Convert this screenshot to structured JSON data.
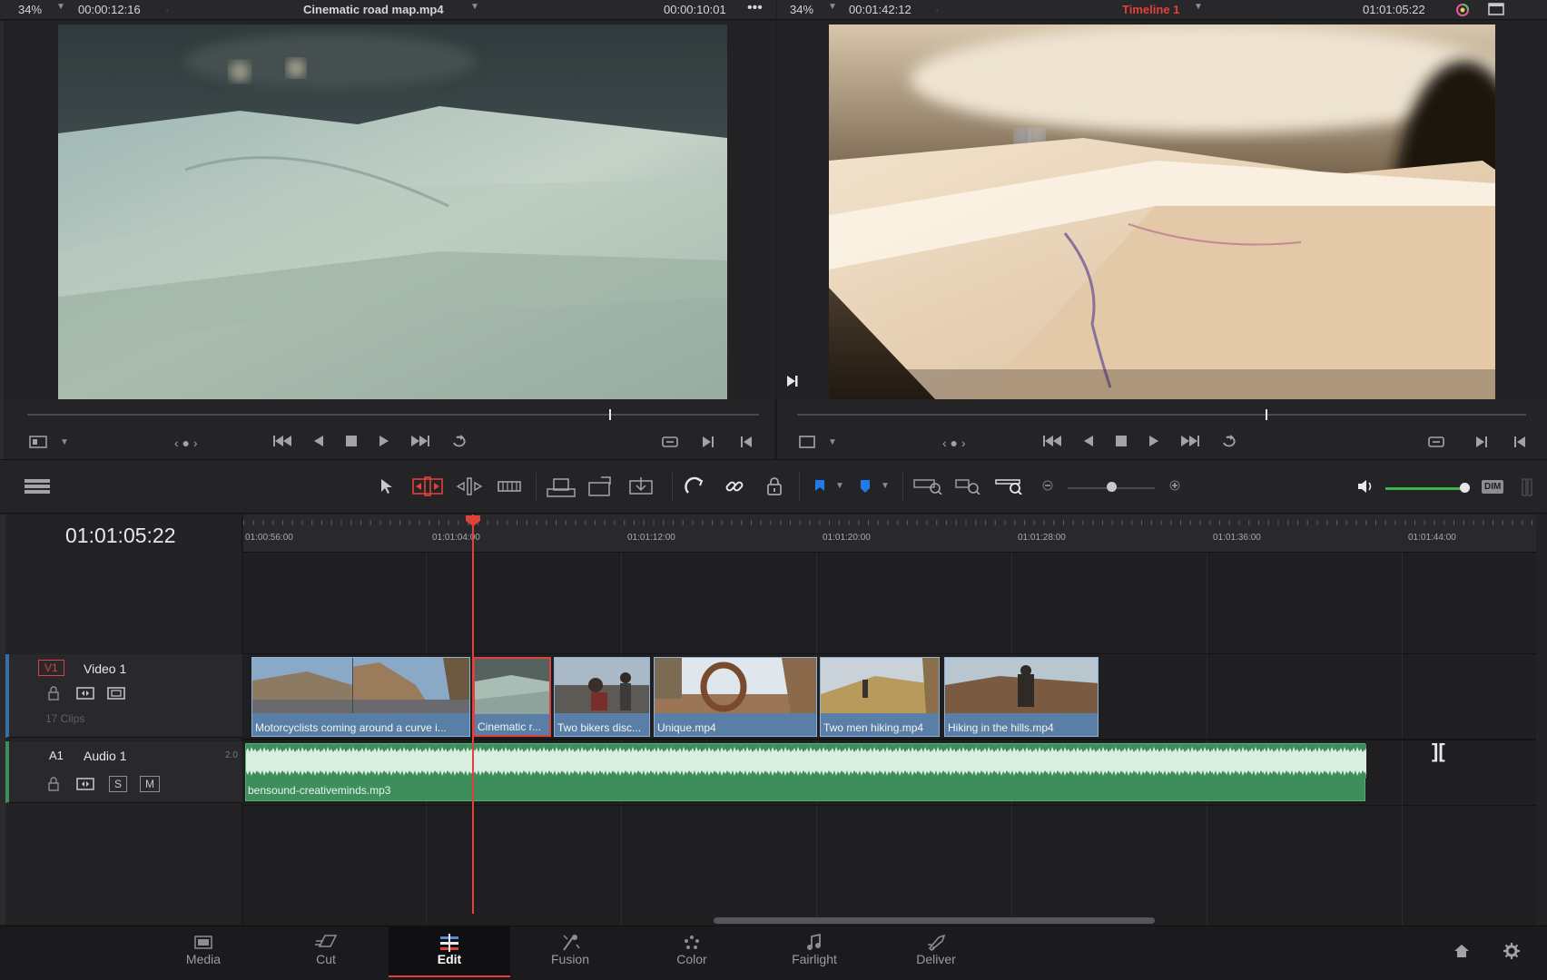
{
  "source_viewer": {
    "zoom": "34%",
    "duration": "00:00:12:16",
    "clip_name": "Cinematic road map.mp4",
    "timecode": "00:00:10:01"
  },
  "timeline_viewer": {
    "zoom": "34%",
    "duration": "00:01:42:12",
    "timeline_name": "Timeline 1",
    "timecode": "01:01:05:22"
  },
  "timeline": {
    "current_timecode": "01:01:05:22",
    "ruler_labels": [
      "01:00:56:00",
      "01:01:04:00",
      "01:01:12:00",
      "01:01:20:00",
      "01:01:28:00",
      "01:01:36:00",
      "01:01:44:00"
    ],
    "video_track": {
      "id": "V1",
      "name": "Video 1",
      "clip_count": "17 Clips",
      "clips": [
        {
          "name": "Motorcyclists coming around a curve i..."
        },
        {
          "name": "Cinematic r..."
        },
        {
          "name": "Two bikers disc..."
        },
        {
          "name": "Unique.mp4"
        },
        {
          "name": "Two men hiking.mp4"
        },
        {
          "name": "Hiking in the hills.mp4"
        }
      ]
    },
    "audio_track": {
      "id": "A1",
      "name": "Audio 1",
      "channels": "2.0",
      "solo": "S",
      "mute": "M",
      "clip_name": "bensound-creativeminds.mp3"
    }
  },
  "toolbar": {
    "dim_label": "DIM",
    "zoom_level": 0.5,
    "volume_level": 0.95
  },
  "pages": {
    "tabs": [
      "Media",
      "Cut",
      "Edit",
      "Fusion",
      "Color",
      "Fairlight",
      "Deliver"
    ],
    "active": "Edit"
  },
  "colors": {
    "accent_red": "#e0413a",
    "clip_blue": "#5a7fa6",
    "audio_green": "#3d8e5a",
    "volume_green": "#3bb54a",
    "flag_blue": "#1e7be8"
  }
}
